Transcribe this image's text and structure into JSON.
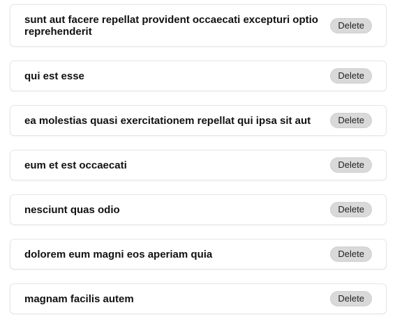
{
  "posts": [
    {
      "title": "sunt aut facere repellat provident occaecati excepturi optio reprehenderit",
      "delete_label": "Delete"
    },
    {
      "title": "qui est esse",
      "delete_label": "Delete"
    },
    {
      "title": "ea molestias quasi exercitationem repellat qui ipsa sit aut",
      "delete_label": "Delete"
    },
    {
      "title": "eum et est occaecati",
      "delete_label": "Delete"
    },
    {
      "title": "nesciunt quas odio",
      "delete_label": "Delete"
    },
    {
      "title": "dolorem eum magni eos aperiam quia",
      "delete_label": "Delete"
    },
    {
      "title": "magnam facilis autem",
      "delete_label": "Delete"
    }
  ]
}
